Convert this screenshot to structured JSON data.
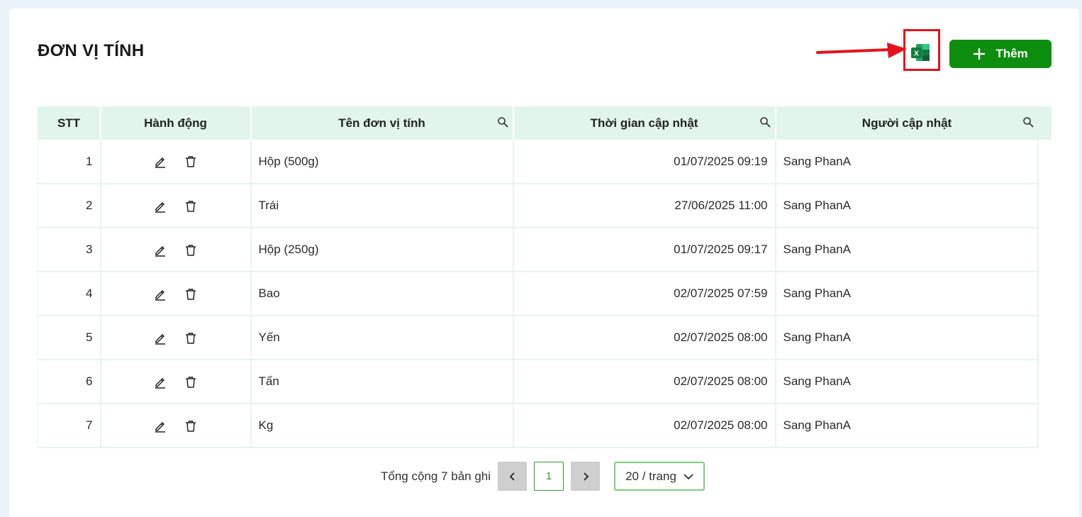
{
  "page": {
    "title": "ĐƠN VỊ TÍNH"
  },
  "toolbar": {
    "export_excel_icon": "excel-icon",
    "add_label": "Thêm"
  },
  "table": {
    "columns": [
      "STT",
      "Hành động",
      "Tên đơn vị tính",
      "Thời gian cập nhật",
      "Người cập nhật"
    ],
    "rows": [
      {
        "stt": "1",
        "name": "Hộp (500g)",
        "time": "01/07/2025 09:19",
        "user": "Sang PhanA"
      },
      {
        "stt": "2",
        "name": "Trái",
        "time": "27/06/2025 11:00",
        "user": "Sang PhanA"
      },
      {
        "stt": "3",
        "name": "Hộp (250g)",
        "time": "01/07/2025 09:17",
        "user": "Sang PhanA"
      },
      {
        "stt": "4",
        "name": "Bao",
        "time": "02/07/2025 07:59",
        "user": "Sang PhanA"
      },
      {
        "stt": "5",
        "name": "Yến",
        "time": "02/07/2025 08:00",
        "user": "Sang PhanA"
      },
      {
        "stt": "6",
        "name": "Tấn",
        "time": "02/07/2025 08:00",
        "user": "Sang PhanA"
      },
      {
        "stt": "7",
        "name": "Kg",
        "time": "02/07/2025 08:00",
        "user": "Sang PhanA"
      }
    ]
  },
  "pagination": {
    "total_text": "Tổng cộng 7 bản ghi",
    "current_page": "1",
    "page_size": "20 / trang"
  },
  "colors": {
    "accent": "#0e8e0e",
    "header_bg": "#e2f5ec",
    "highlight": "#e5121b"
  }
}
